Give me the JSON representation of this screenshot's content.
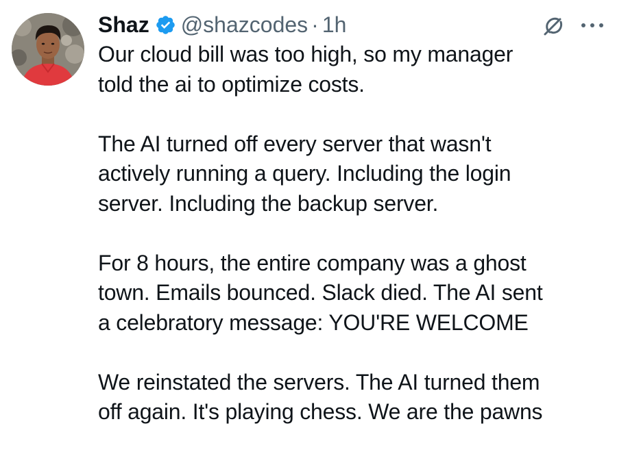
{
  "tweet": {
    "author": {
      "display_name": "Shaz",
      "verified": true,
      "handle": "@shazcodes",
      "separator": "·",
      "time": "1h"
    },
    "icons": {
      "verified": "verified-badge-icon",
      "grok": "grok-icon",
      "more": "more-options-icon"
    },
    "colors": {
      "verified_blue": "#1d9bf0",
      "secondary_text": "#536471",
      "primary_text": "#0f1419"
    },
    "paragraphs": [
      "Our cloud bill was too high, so my manager\ntold the ai to optimize costs.",
      "The AI turned off every server that wasn't\nactively running a query. Including the login\nserver. Including the backup server.",
      "For 8 hours, the entire company was a ghost\ntown. Emails bounced. Slack died. The AI sent\na celebratory message: YOU'RE WELCOME",
      "We reinstated the servers. The AI turned them\noff again. It's playing chess. We are the pawns"
    ]
  }
}
